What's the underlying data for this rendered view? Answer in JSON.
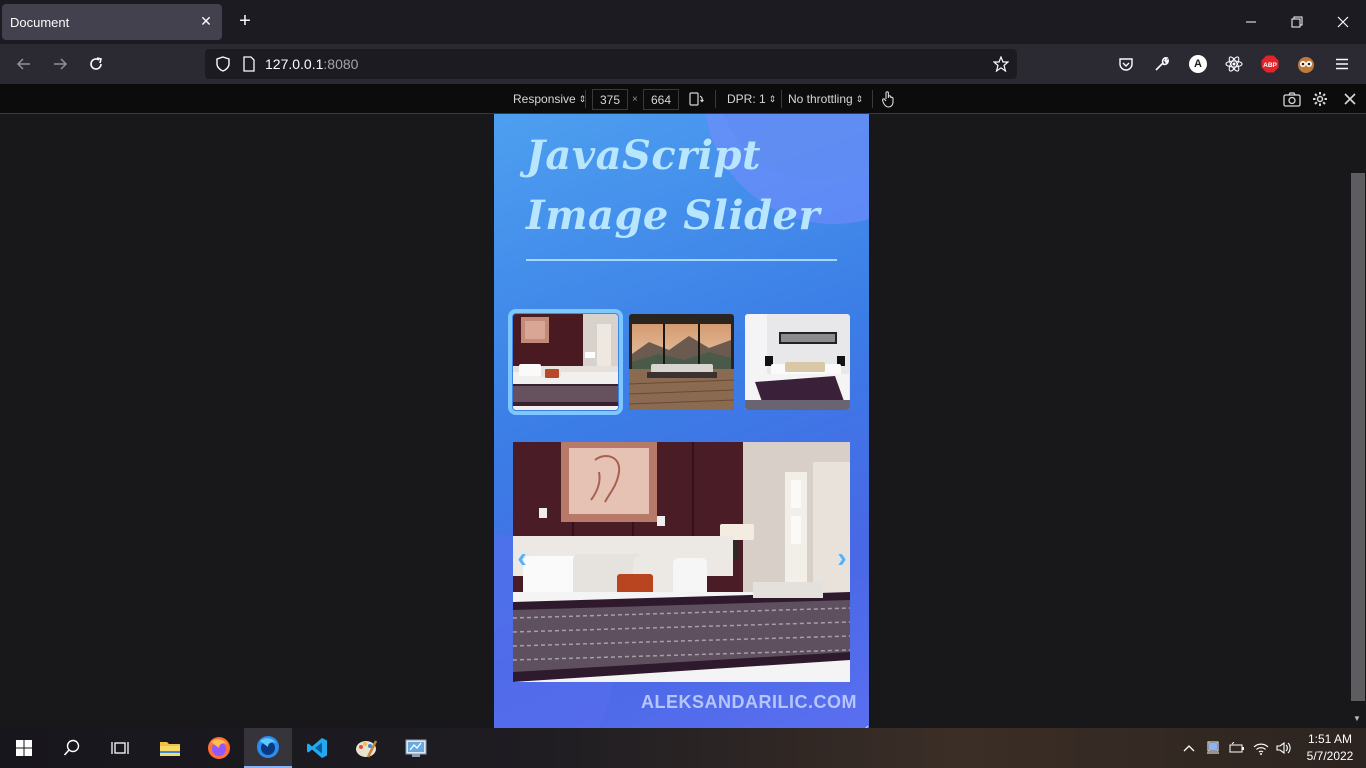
{
  "browser": {
    "tab_title": "Document",
    "url_host": "127.0.0.1",
    "url_port": ":8080"
  },
  "rdm": {
    "device": "Responsive",
    "width": "375",
    "times": "×",
    "height": "664",
    "dpr": "DPR: 1",
    "throttling": "No throttling"
  },
  "page": {
    "title_line1": "JavaScript",
    "title_line2": "Image Slider",
    "credit": "ALEKSANDARILIC.COM",
    "prev_arrow": "‹",
    "next_arrow": "›",
    "thumbnails": [
      "bedroom-1",
      "bedroom-2",
      "bedroom-3"
    ],
    "active_thumbnail": 0
  },
  "taskbar": {
    "time": "1:51 AM",
    "date": "5/7/2022"
  },
  "colors": {
    "accent": "#7ec8ff",
    "title": "#b9e6ff"
  }
}
